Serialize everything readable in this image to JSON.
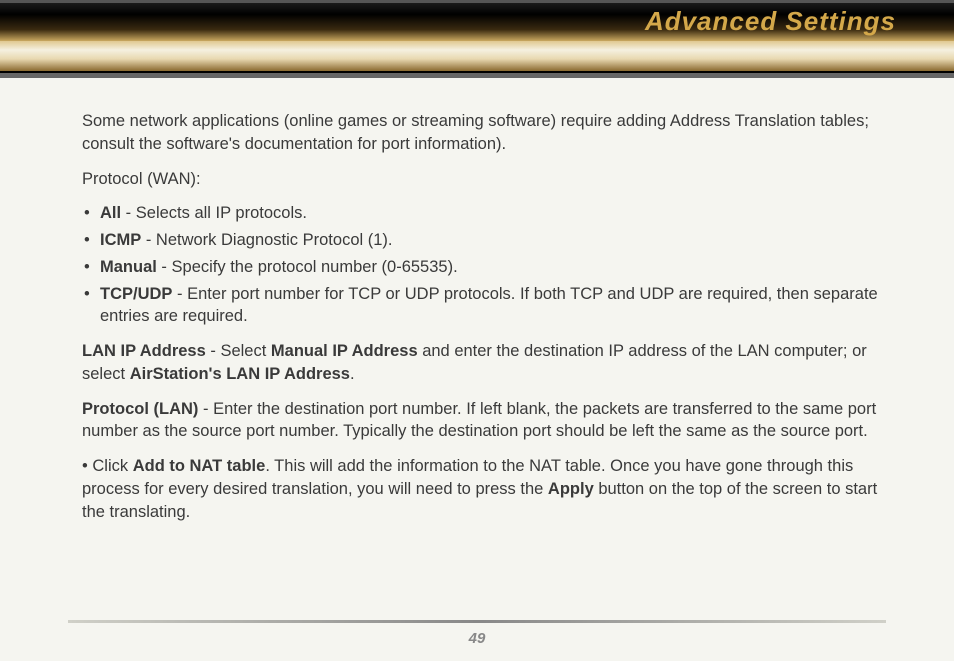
{
  "header": {
    "title": "Advanced Settings"
  },
  "body": {
    "intro": "Some network applications (online games or streaming software) require adding Address Translation tables; consult the software's documentation for port information).",
    "protocolWanLabel": "Protocol (WAN):",
    "bullets": {
      "allLabel": "All",
      "allDesc": " - Selects all IP protocols.",
      "icmpLabel": "ICMP",
      "icmpDesc": " - Network Diagnostic Protocol (1).",
      "manualLabel": "Manual",
      "manualDesc": " - Specify the protocol number (0-65535).",
      "tcpudpLabel": "TCP/UDP",
      "tcpudpDesc": " - Enter port number for TCP or UDP protocols.  If both TCP and UDP are required, then separate entries are required."
    },
    "lanIpLabel": "LAN IP Address",
    "lanIpMid1": " - Select ",
    "lanIpBold1": "Manual IP Address",
    "lanIpMid2": " and enter the destination IP address of the LAN computer; or select ",
    "lanIpBold2": "AirStation's LAN IP Address",
    "lanIpEnd": ".",
    "protoLanLabel": "Protocol (LAN)",
    "protoLanDesc": " - Enter the destination port number.  If left blank, the packets are transferred to the same port number as the source port number.  Typically the destination port should be left the same as the source port.",
    "clickPrefix": "• Click ",
    "addNatBold": "Add to NAT table",
    "clickMid": ".  This will add the information to the NAT table.  Once you have gone through this process for every desired translation, you will need to press the ",
    "applyBold": "Apply",
    "clickEnd": " button on the top of the screen to start the translating."
  },
  "footer": {
    "page": "49"
  }
}
